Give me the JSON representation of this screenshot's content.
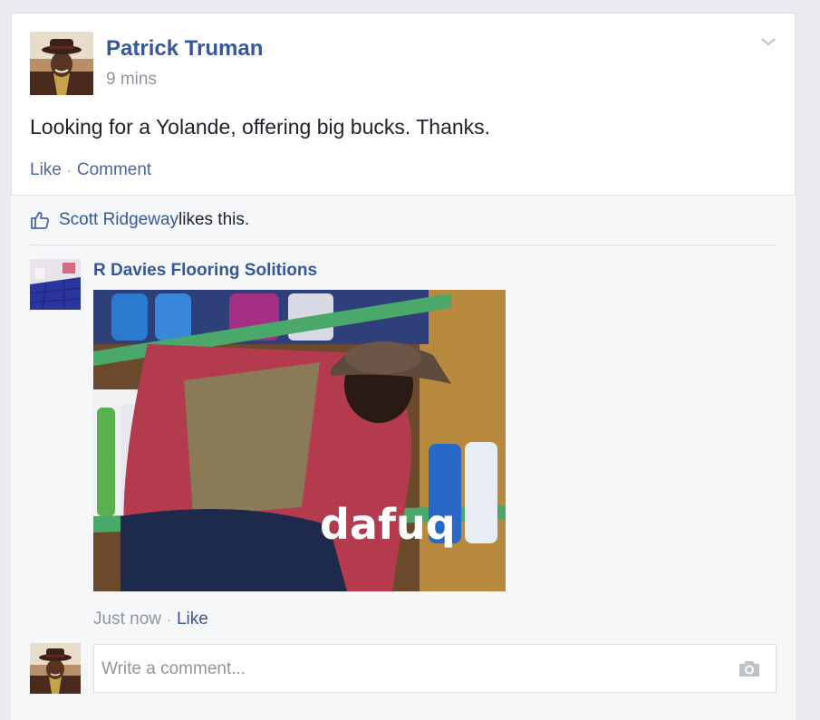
{
  "post": {
    "author": "Patrick Truman",
    "time": "9 mins",
    "text": "Looking for a Yolande, offering big bucks. Thanks.",
    "actions": {
      "like": "Like",
      "separator": "·",
      "comment": "Comment"
    }
  },
  "likes": {
    "liker": "Scott Ridgeway",
    "suffix": " likes this."
  },
  "comment": {
    "author": "R Davies Flooring Solitions",
    "image_caption": "dafuq",
    "time": "Just now",
    "separator": "·",
    "like": "Like"
  },
  "composer": {
    "placeholder": "Write a comment..."
  },
  "icons": {
    "chevron": "chevron-down-icon",
    "thumb": "thumbs-up-icon",
    "camera": "camera-icon"
  },
  "colors": {
    "link": "#365899",
    "muted": "#90949c",
    "text": "#1d2129",
    "background": "#e9ebee"
  }
}
